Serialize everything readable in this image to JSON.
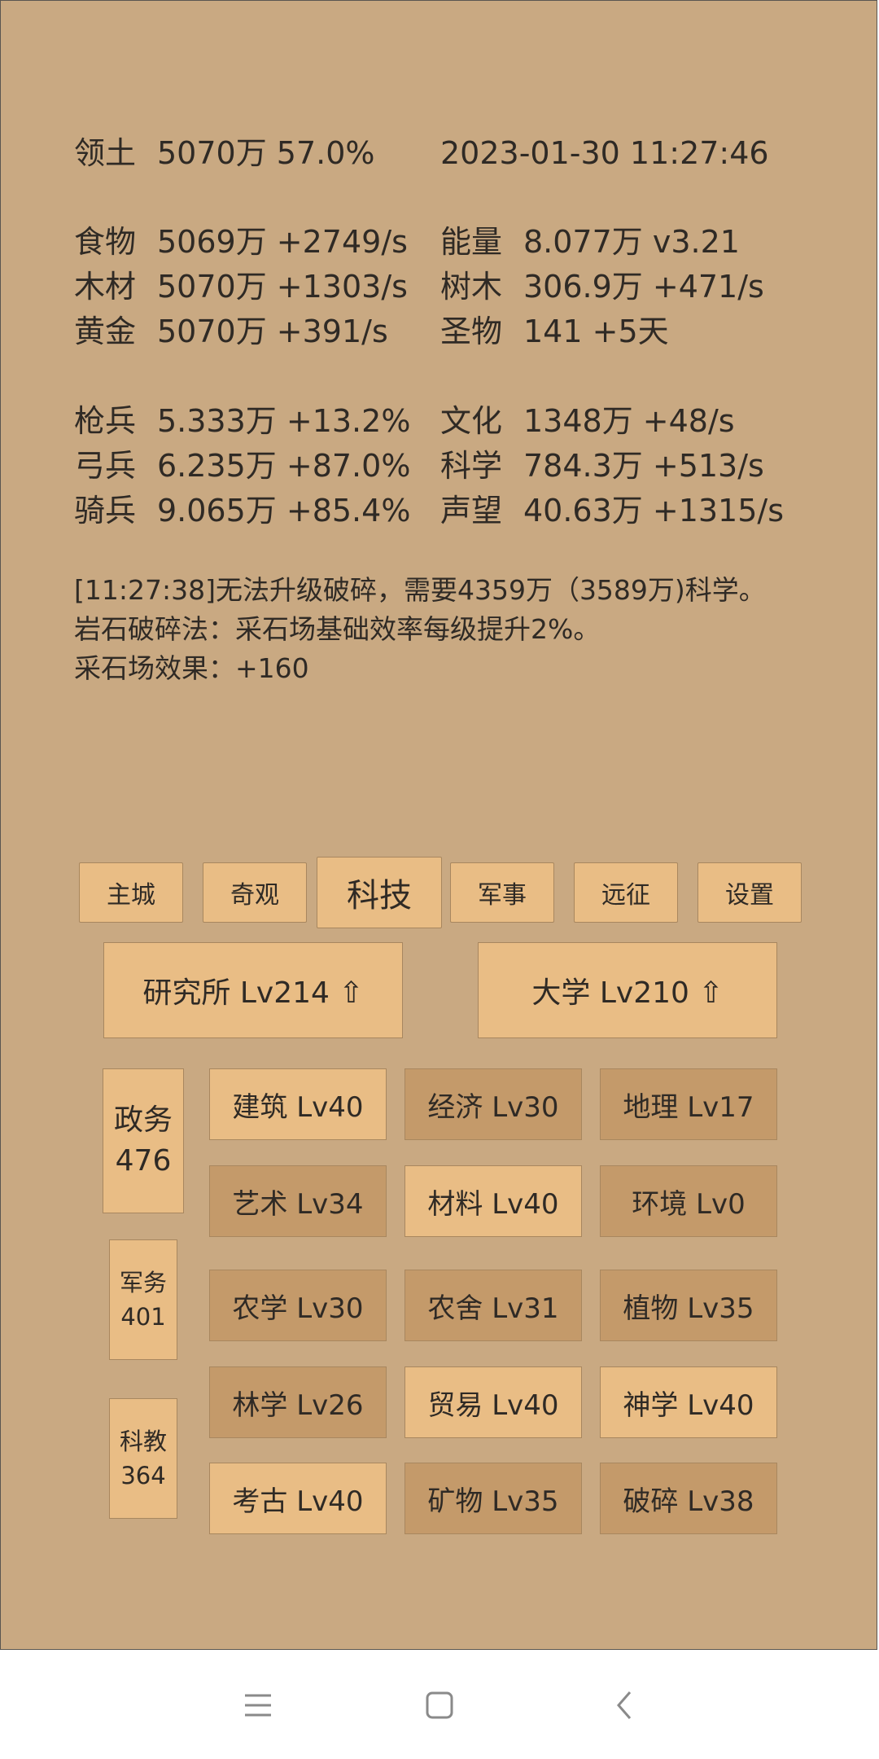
{
  "stats": {
    "territory": {
      "label": "领土",
      "value": "5070万  57.0%"
    },
    "datetime": "2023-01-30 11:27:46",
    "left": [
      {
        "label": "食物",
        "value": "5069万 +2749/s"
      },
      {
        "label": "木材",
        "value": "5070万 +1303/s"
      },
      {
        "label": "黄金",
        "value": "5070万 +391/s"
      },
      {
        "label": "枪兵",
        "value": "5.333万 +13.2%"
      },
      {
        "label": "弓兵",
        "value": "6.235万 +87.0%"
      },
      {
        "label": "骑兵",
        "value": "9.065万 +85.4%"
      }
    ],
    "right": [
      {
        "label": "能量",
        "value": "8.077万  v3.21"
      },
      {
        "label": "树木",
        "value": "306.9万 +471/s"
      },
      {
        "label": "圣物",
        "value": "141 +5天"
      },
      {
        "label": "文化",
        "value": "1348万 +48/s"
      },
      {
        "label": "科学",
        "value": "784.3万 +513/s"
      },
      {
        "label": "声望",
        "value": "40.63万 +1315/s"
      }
    ]
  },
  "log": [
    "[11:27:38]无法升级破碎，需要4359万（3589万)科学。",
    "岩石破碎法：采石场基础效率每级提升2%。",
    "采石场效果：+160"
  ],
  "tabs": [
    "主城",
    "奇观",
    "科技",
    "军事",
    "远征",
    "设置"
  ],
  "active_tab": "科技",
  "buildings": [
    "研究所 Lv214 ⇧",
    "大学 Lv210 ⇧"
  ],
  "categories": [
    {
      "name": "政务",
      "count": "476"
    },
    {
      "name": "军务",
      "count": "401"
    },
    {
      "name": "科教",
      "count": "364"
    }
  ],
  "techs": [
    {
      "label": "建筑 Lv40",
      "tone": "light"
    },
    {
      "label": "经济 Lv30",
      "tone": "dark"
    },
    {
      "label": "地理 Lv17",
      "tone": "dark"
    },
    {
      "label": "艺术 Lv34",
      "tone": "dark"
    },
    {
      "label": "材料 Lv40",
      "tone": "light"
    },
    {
      "label": "环境 Lv0",
      "tone": "dark"
    },
    {
      "label": "农学 Lv30",
      "tone": "dark"
    },
    {
      "label": "农舍 Lv31",
      "tone": "dark"
    },
    {
      "label": "植物 Lv35",
      "tone": "dark"
    },
    {
      "label": "林学 Lv26",
      "tone": "dark"
    },
    {
      "label": "贸易 Lv40",
      "tone": "light"
    },
    {
      "label": "神学 Lv40",
      "tone": "light"
    },
    {
      "label": "考古 Lv40",
      "tone": "light"
    },
    {
      "label": "矿物 Lv35",
      "tone": "dark"
    },
    {
      "label": "破碎 Lv38",
      "tone": "dark"
    }
  ],
  "colors": {
    "background": "#c9a982",
    "button_light": "#e9bd85",
    "button_dark": "#c49a6a",
    "text": "#2f2a25"
  },
  "nav_icons": [
    "menu-icon",
    "home-icon",
    "back-icon"
  ]
}
